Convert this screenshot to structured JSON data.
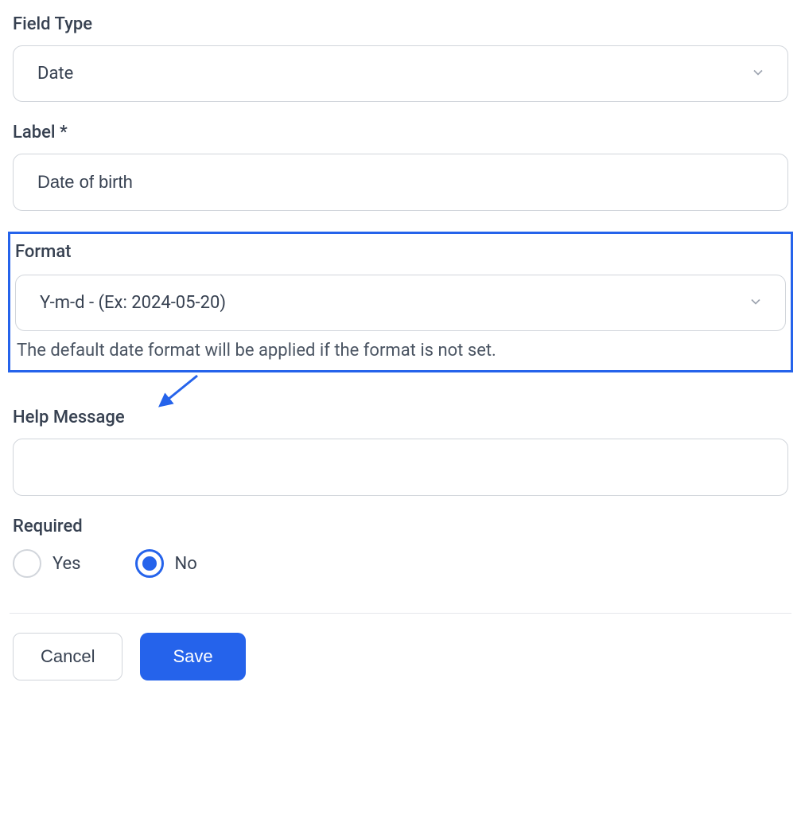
{
  "fieldType": {
    "label": "Field Type",
    "value": "Date"
  },
  "label": {
    "label": "Label *",
    "value": "Date of birth"
  },
  "format": {
    "label": "Format",
    "value": "Y-m-d - (Ex: 2024-05-20)",
    "helper": "The default date format will be applied if the format is not set."
  },
  "helpMessage": {
    "label": "Help Message",
    "value": ""
  },
  "required": {
    "label": "Required",
    "options": {
      "yes": "Yes",
      "no": "No"
    },
    "selected": "no"
  },
  "buttons": {
    "cancel": "Cancel",
    "save": "Save"
  }
}
